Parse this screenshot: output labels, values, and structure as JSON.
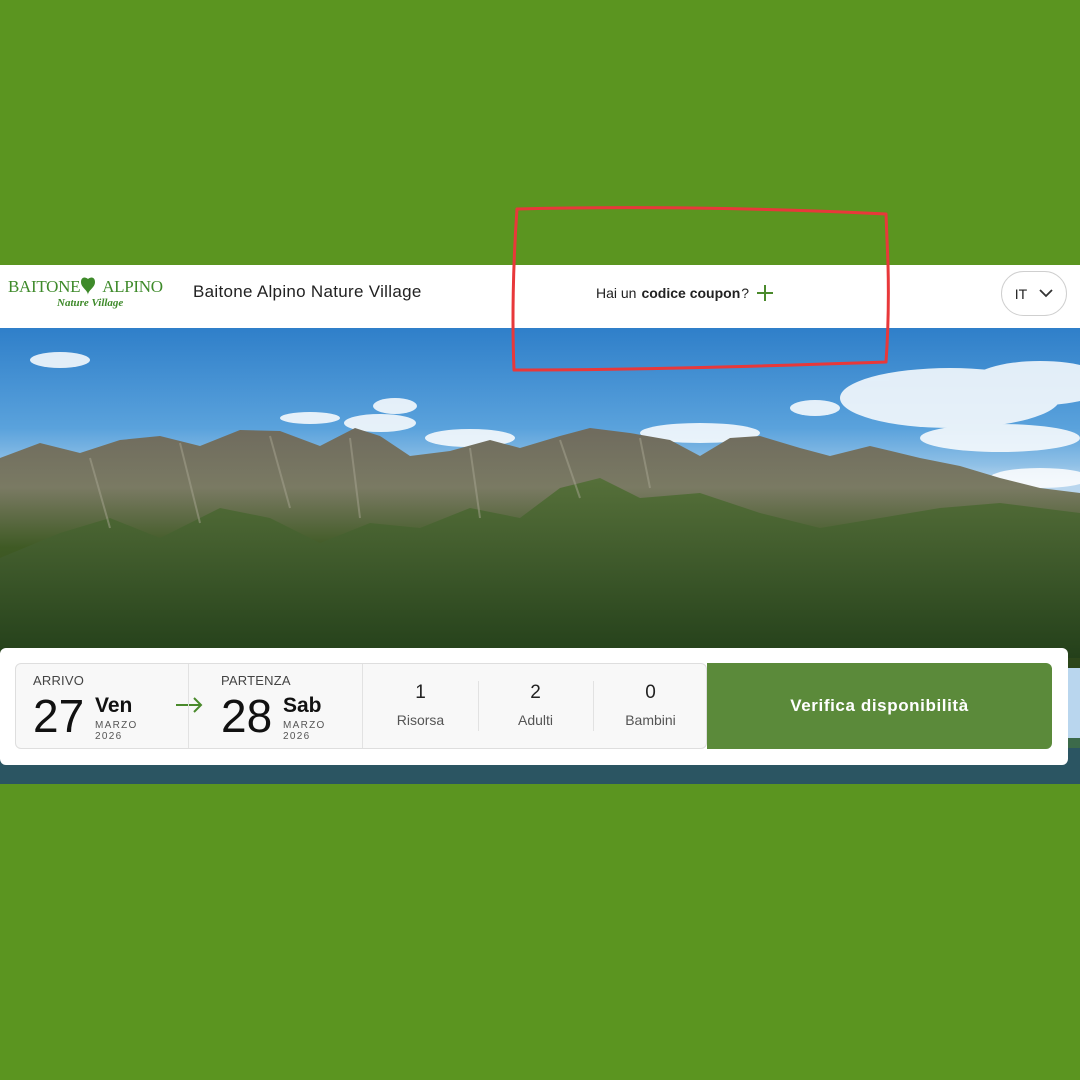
{
  "header": {
    "logo": {
      "word1": "BAITONE",
      "word2": "ALPINO",
      "tagline": "Nature Village"
    },
    "site_title": "Baitone Alpino Nature Village",
    "coupon": {
      "prefix": "Hai un",
      "bold": "codice coupon",
      "suffix": "?"
    },
    "language": "IT"
  },
  "booking": {
    "arrival": {
      "label": "ARRIVO",
      "day": "27",
      "weekday": "Ven",
      "month": "MARZO",
      "year": "2026"
    },
    "departure": {
      "label": "PARTENZA",
      "day": "28",
      "weekday": "Sab",
      "month": "MARZO",
      "year": "2026"
    },
    "counts": [
      {
        "value": "1",
        "label": "Risorsa"
      },
      {
        "value": "2",
        "label": "Adulti"
      },
      {
        "value": "0",
        "label": "Bambini"
      }
    ],
    "cta_label": "Verifica disponibilità"
  },
  "colors": {
    "page_background": "#5b9520",
    "brand_green": "#3e8a2a",
    "cta_green": "#5b8a3a",
    "annotation_red": "#e8383a"
  }
}
